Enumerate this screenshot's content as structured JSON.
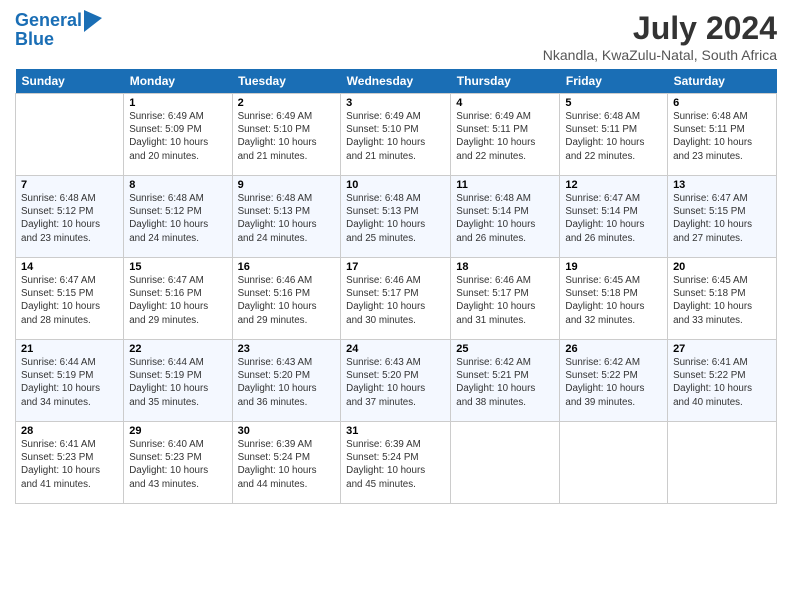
{
  "logo": {
    "line1": "General",
    "line2": "Blue"
  },
  "title": "July 2024",
  "location": "Nkandla, KwaZulu-Natal, South Africa",
  "days_of_week": [
    "Sunday",
    "Monday",
    "Tuesday",
    "Wednesday",
    "Thursday",
    "Friday",
    "Saturday"
  ],
  "weeks": [
    [
      {
        "day": "",
        "info": ""
      },
      {
        "day": "1",
        "info": "Sunrise: 6:49 AM\nSunset: 5:09 PM\nDaylight: 10 hours\nand 20 minutes."
      },
      {
        "day": "2",
        "info": "Sunrise: 6:49 AM\nSunset: 5:10 PM\nDaylight: 10 hours\nand 21 minutes."
      },
      {
        "day": "3",
        "info": "Sunrise: 6:49 AM\nSunset: 5:10 PM\nDaylight: 10 hours\nand 21 minutes."
      },
      {
        "day": "4",
        "info": "Sunrise: 6:49 AM\nSunset: 5:11 PM\nDaylight: 10 hours\nand 22 minutes."
      },
      {
        "day": "5",
        "info": "Sunrise: 6:48 AM\nSunset: 5:11 PM\nDaylight: 10 hours\nand 22 minutes."
      },
      {
        "day": "6",
        "info": "Sunrise: 6:48 AM\nSunset: 5:11 PM\nDaylight: 10 hours\nand 23 minutes."
      }
    ],
    [
      {
        "day": "7",
        "info": "Sunrise: 6:48 AM\nSunset: 5:12 PM\nDaylight: 10 hours\nand 23 minutes."
      },
      {
        "day": "8",
        "info": "Sunrise: 6:48 AM\nSunset: 5:12 PM\nDaylight: 10 hours\nand 24 minutes."
      },
      {
        "day": "9",
        "info": "Sunrise: 6:48 AM\nSunset: 5:13 PM\nDaylight: 10 hours\nand 24 minutes."
      },
      {
        "day": "10",
        "info": "Sunrise: 6:48 AM\nSunset: 5:13 PM\nDaylight: 10 hours\nand 25 minutes."
      },
      {
        "day": "11",
        "info": "Sunrise: 6:48 AM\nSunset: 5:14 PM\nDaylight: 10 hours\nand 26 minutes."
      },
      {
        "day": "12",
        "info": "Sunrise: 6:47 AM\nSunset: 5:14 PM\nDaylight: 10 hours\nand 26 minutes."
      },
      {
        "day": "13",
        "info": "Sunrise: 6:47 AM\nSunset: 5:15 PM\nDaylight: 10 hours\nand 27 minutes."
      }
    ],
    [
      {
        "day": "14",
        "info": "Sunrise: 6:47 AM\nSunset: 5:15 PM\nDaylight: 10 hours\nand 28 minutes."
      },
      {
        "day": "15",
        "info": "Sunrise: 6:47 AM\nSunset: 5:16 PM\nDaylight: 10 hours\nand 29 minutes."
      },
      {
        "day": "16",
        "info": "Sunrise: 6:46 AM\nSunset: 5:16 PM\nDaylight: 10 hours\nand 29 minutes."
      },
      {
        "day": "17",
        "info": "Sunrise: 6:46 AM\nSunset: 5:17 PM\nDaylight: 10 hours\nand 30 minutes."
      },
      {
        "day": "18",
        "info": "Sunrise: 6:46 AM\nSunset: 5:17 PM\nDaylight: 10 hours\nand 31 minutes."
      },
      {
        "day": "19",
        "info": "Sunrise: 6:45 AM\nSunset: 5:18 PM\nDaylight: 10 hours\nand 32 minutes."
      },
      {
        "day": "20",
        "info": "Sunrise: 6:45 AM\nSunset: 5:18 PM\nDaylight: 10 hours\nand 33 minutes."
      }
    ],
    [
      {
        "day": "21",
        "info": "Sunrise: 6:44 AM\nSunset: 5:19 PM\nDaylight: 10 hours\nand 34 minutes."
      },
      {
        "day": "22",
        "info": "Sunrise: 6:44 AM\nSunset: 5:19 PM\nDaylight: 10 hours\nand 35 minutes."
      },
      {
        "day": "23",
        "info": "Sunrise: 6:43 AM\nSunset: 5:20 PM\nDaylight: 10 hours\nand 36 minutes."
      },
      {
        "day": "24",
        "info": "Sunrise: 6:43 AM\nSunset: 5:20 PM\nDaylight: 10 hours\nand 37 minutes."
      },
      {
        "day": "25",
        "info": "Sunrise: 6:42 AM\nSunset: 5:21 PM\nDaylight: 10 hours\nand 38 minutes."
      },
      {
        "day": "26",
        "info": "Sunrise: 6:42 AM\nSunset: 5:22 PM\nDaylight: 10 hours\nand 39 minutes."
      },
      {
        "day": "27",
        "info": "Sunrise: 6:41 AM\nSunset: 5:22 PM\nDaylight: 10 hours\nand 40 minutes."
      }
    ],
    [
      {
        "day": "28",
        "info": "Sunrise: 6:41 AM\nSunset: 5:23 PM\nDaylight: 10 hours\nand 41 minutes."
      },
      {
        "day": "29",
        "info": "Sunrise: 6:40 AM\nSunset: 5:23 PM\nDaylight: 10 hours\nand 43 minutes."
      },
      {
        "day": "30",
        "info": "Sunrise: 6:39 AM\nSunset: 5:24 PM\nDaylight: 10 hours\nand 44 minutes."
      },
      {
        "day": "31",
        "info": "Sunrise: 6:39 AM\nSunset: 5:24 PM\nDaylight: 10 hours\nand 45 minutes."
      },
      {
        "day": "",
        "info": ""
      },
      {
        "day": "",
        "info": ""
      },
      {
        "day": "",
        "info": ""
      }
    ]
  ]
}
